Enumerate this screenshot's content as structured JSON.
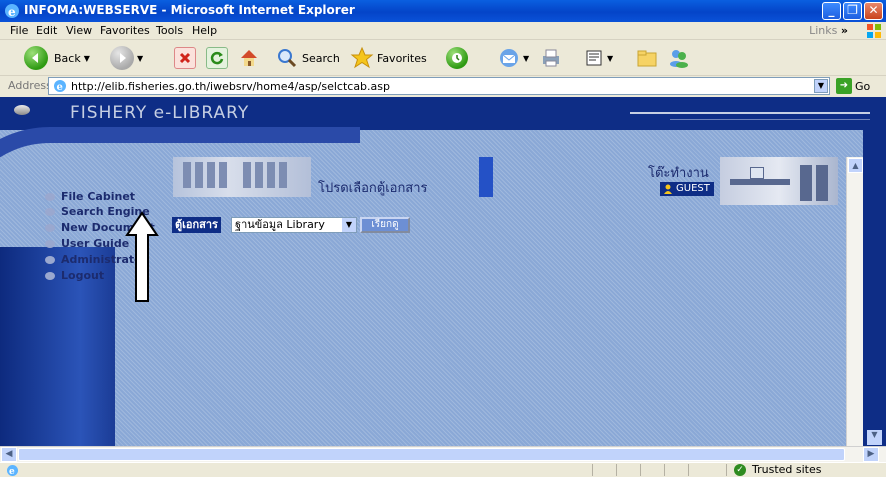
{
  "window": {
    "title": "INFOMA:WEBSERVE - Microsoft Internet Explorer",
    "minimize": "_",
    "maximize": "❐",
    "close": "✕"
  },
  "menubar": {
    "items": [
      "File",
      "Edit",
      "View",
      "Favorites",
      "Tools",
      "Help"
    ],
    "links_label": "Links",
    "links_chevron": "»"
  },
  "toolbar": {
    "back_label": "Back",
    "search_label": "Search",
    "favorites_label": "Favorites"
  },
  "addressbar": {
    "label": "Address",
    "url": "http://elib.fisheries.go.th/iwebsrv/home4/asp/selctcab.asp",
    "go_label": "Go"
  },
  "page": {
    "brand": "FISHERY e-LIBRARY",
    "nav_items": [
      "File Cabinet",
      "Search Engine",
      "New Document",
      "User Guide",
      "Administrator",
      "Logout"
    ],
    "prompt": "โปรดเลือกตู้เอกสาร",
    "desk_label": "โต๊ะทำงาน",
    "guest_label": "GUEST",
    "cabinet_label": "ตู้เอกสาร",
    "cabinet_selected": "ฐานข้อมูล Library",
    "ok_button": "เรียกดู"
  },
  "statusbar": {
    "zone": "Trusted sites"
  },
  "colors": {
    "header_navy": "#0e2d86",
    "content_blue": "#8aa8d6",
    "xp_titlebar": "#0a5fe0"
  }
}
